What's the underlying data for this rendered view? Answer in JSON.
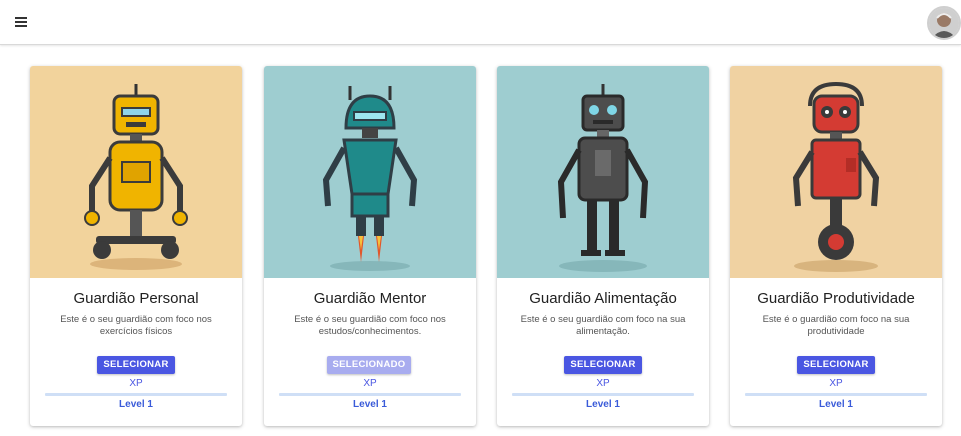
{
  "topbar": {
    "menu_icon": "hamburger-menu-icon",
    "avatar_icon": "user-avatar"
  },
  "colors": {
    "button_active": "#4a56e2",
    "button_selected": "#a8acef",
    "card_bg_yellow": "#f2d39c",
    "card_bg_teal": "#9ecdd0",
    "card_bg_peach": "#f0d2a2"
  },
  "cards": [
    {
      "title": "Guardião Personal",
      "description": "Este é o seu guardião com foco nos exercícios físicos",
      "button_label": "SELECIONAR",
      "button_state": "active",
      "xp_label": "XP",
      "xp_progress": 0,
      "level_label": "Level 1",
      "image_icon": "yellow-robot-illustration"
    },
    {
      "title": "Guardião Mentor",
      "description": "Este é o seu guardião com foco nos estudos/conhecimentos.",
      "button_label": "SELECIONADO",
      "button_state": "selected",
      "xp_label": "XP",
      "xp_progress": 0,
      "level_label": "Level 1",
      "image_icon": "teal-rocket-robot-illustration"
    },
    {
      "title": "Guardião Alimentação",
      "description": "Este é o seu guardião com foco na sua alimentação.",
      "button_label": "SELECIONAR",
      "button_state": "active",
      "xp_label": "XP",
      "xp_progress": 0,
      "level_label": "Level 1",
      "image_icon": "gray-robot-illustration"
    },
    {
      "title": "Guardião Produtividade",
      "description": "Este é o guardião com foco na sua produtividade",
      "button_label": "SELECIONAR",
      "button_state": "active",
      "xp_label": "XP",
      "xp_progress": 0,
      "level_label": "Level 1",
      "image_icon": "red-wheel-robot-illustration"
    }
  ]
}
